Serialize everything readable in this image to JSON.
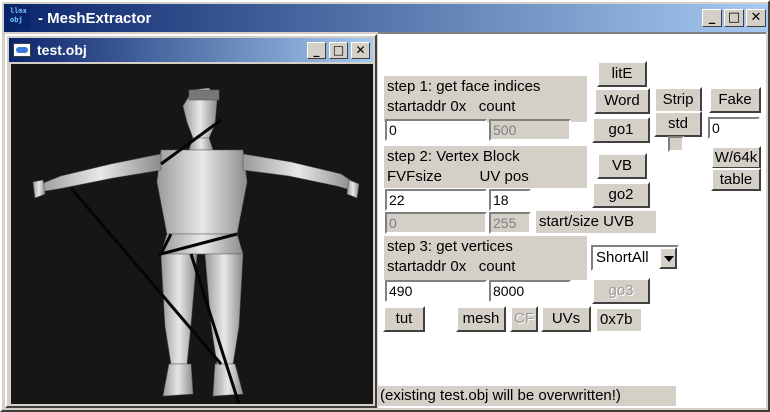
{
  "app": {
    "title": "MeshExtractor",
    "icon_text": "ll⊗x obj",
    "icon": "app-icon",
    "window_buttons": {
      "minimize": "_",
      "maximize": "□",
      "close": "✕"
    }
  },
  "child_window": {
    "title": "test.obj",
    "icon": "window-icon",
    "window_buttons": {
      "minimize": "_",
      "maximize": "□",
      "close": "✕"
    }
  },
  "step1": {
    "heading": "step 1: get face indices",
    "startaddr_label": "startaddr 0x",
    "count_label": "count",
    "startaddr_value": "0",
    "count_value": "500"
  },
  "step2": {
    "heading": "step 2: Vertex Block",
    "fvfsize_label": "FVFsize",
    "uvpos_label": "UV pos",
    "fvfsize_value": "22",
    "uvpos_value": "18",
    "start_value": "0",
    "size_value": "255",
    "start_size_label": "start/size UVB"
  },
  "step3": {
    "heading": "step 3: get vertices",
    "startaddr_label": "startaddr 0x",
    "count_label": "count",
    "startaddr_value": "490",
    "count_value": "8000"
  },
  "buttons": {
    "lite": "litE",
    "word": "Word",
    "strip": "Strip",
    "fake": "Fake",
    "go1": "go1",
    "std": "std",
    "vb": "VB",
    "w64k": "W/64k",
    "table": "table",
    "go2": "go2",
    "go3": "go3",
    "tut": "tut",
    "mesh": "mesh",
    "cf": "CF",
    "uvs": "UVs"
  },
  "side_field_value": "0",
  "dropdown": {
    "selected": "ShortAll"
  },
  "hex_readout": "0x7b",
  "footer_note": "(existing test.obj will be overwritten!)",
  "colors": {
    "titlebar_start": "#0a246a",
    "titlebar_end": "#a6caf0",
    "viewport_bg": "#161616",
    "face": "#d4d0c8"
  }
}
